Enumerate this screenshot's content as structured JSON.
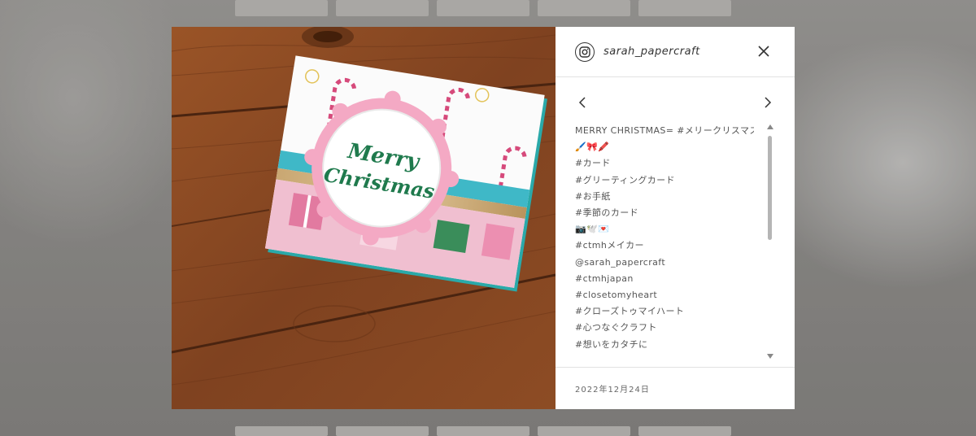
{
  "post": {
    "username": "sarah_papercraft",
    "date": "2022年12月24日",
    "photo": {
      "card_text_line1": "Merry",
      "card_text_line2": "Christmas"
    },
    "caption_lines": [
      "MERRY CHRISTMAS= #メリークリスマス",
      "🖌️🎀🖍️",
      "#カード",
      "#グリーティングカード",
      "#お手紙",
      "#季節のカード",
      "📷🕊️💌",
      "#ctmhメイカー",
      "@sarah_papercraft",
      "#ctmhjapan",
      "#closetomyheart",
      "#クローズトゥマイハート",
      "#心つなぐクラフト",
      "#想いをカタチに"
    ]
  },
  "colors": {
    "wood": "#8a4a24",
    "panel": "#ffffff",
    "card_green": "#1f7a4d",
    "ribbon": "#3fb8c7"
  },
  "icons": {
    "profile": "instagram-icon",
    "close": "close-icon",
    "prev": "chevron-left-icon",
    "next": "chevron-right-icon"
  }
}
